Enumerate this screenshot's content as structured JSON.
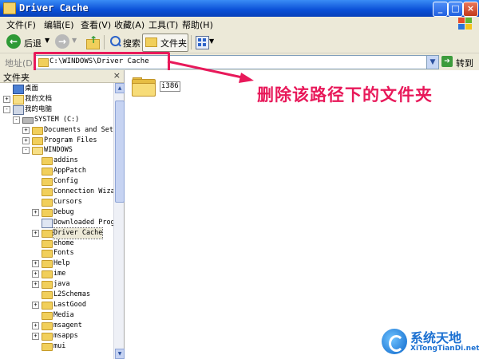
{
  "window": {
    "title": "Driver Cache"
  },
  "menu": [
    "文件(F)",
    "编辑(E)",
    "查看(V)",
    "收藏(A)",
    "工具(T)",
    "帮助(H)"
  ],
  "toolbar": {
    "back_label": "后退",
    "search_label": "搜索",
    "folders_label": "文件夹"
  },
  "address": {
    "label": "地址(D)",
    "value": "C:\\WINDOWS\\Driver Cache",
    "go_label": "转到"
  },
  "folders_panel": {
    "title": "文件夹",
    "close": "×",
    "tree": [
      {
        "label": "桌面",
        "icon": "desktop-icon",
        "expander": ""
      },
      {
        "label": "我的文档",
        "icon": "documents-icon",
        "expander": "+"
      },
      {
        "label": "我的电脑",
        "icon": "computer-icon",
        "expander": "−"
      },
      {
        "label": "SYSTEM (C:)",
        "icon": "drive-icon",
        "expander": "−"
      },
      {
        "label": "Documents and Setti",
        "icon": "folder-icon",
        "expander": "+"
      },
      {
        "label": "Program Files",
        "icon": "folder-icon",
        "expander": "+"
      },
      {
        "label": "WINDOWS",
        "icon": "folder-open-icon",
        "expander": "−"
      },
      {
        "label": "addins",
        "icon": "folder-icon",
        "expander": ""
      },
      {
        "label": "AppPatch",
        "icon": "folder-icon",
        "expander": ""
      },
      {
        "label": "Config",
        "icon": "folder-icon",
        "expander": ""
      },
      {
        "label": "Connection Wizar",
        "icon": "folder-icon",
        "expander": ""
      },
      {
        "label": "Cursors",
        "icon": "folder-icon",
        "expander": ""
      },
      {
        "label": "Debug",
        "icon": "folder-icon",
        "expander": "+"
      },
      {
        "label": "Downloaded Progr",
        "icon": "special-folder-icon",
        "expander": ""
      },
      {
        "label": "Driver Cache",
        "icon": "folder-icon",
        "expander": "+",
        "selected": true
      },
      {
        "label": "ehome",
        "icon": "folder-icon",
        "expander": ""
      },
      {
        "label": "Fonts",
        "icon": "folder-icon",
        "expander": ""
      },
      {
        "label": "Help",
        "icon": "folder-icon",
        "expander": "+"
      },
      {
        "label": "ime",
        "icon": "folder-icon",
        "expander": "+"
      },
      {
        "label": "java",
        "icon": "folder-icon",
        "expander": "+"
      },
      {
        "label": "L2Schemas",
        "icon": "folder-icon",
        "expander": ""
      },
      {
        "label": "LastGood",
        "icon": "folder-icon",
        "expander": "+"
      },
      {
        "label": "Media",
        "icon": "folder-icon",
        "expander": ""
      },
      {
        "label": "msagent",
        "icon": "folder-icon",
        "expander": "+"
      },
      {
        "label": "msapps",
        "icon": "folder-icon",
        "expander": "+"
      },
      {
        "label": "mui",
        "icon": "folder-icon",
        "expander": ""
      }
    ]
  },
  "content": {
    "items": [
      {
        "label": "i386",
        "icon": "folder-icon"
      }
    ]
  },
  "annotation": {
    "text": "删除该路径下的文件夹"
  },
  "watermark": {
    "title": "系统天地",
    "url": "XiTongTianDi.net"
  },
  "colors": {
    "annotation": "#e8195a",
    "titlebar": "#0a4fd6",
    "chrome": "#ece9d8"
  }
}
